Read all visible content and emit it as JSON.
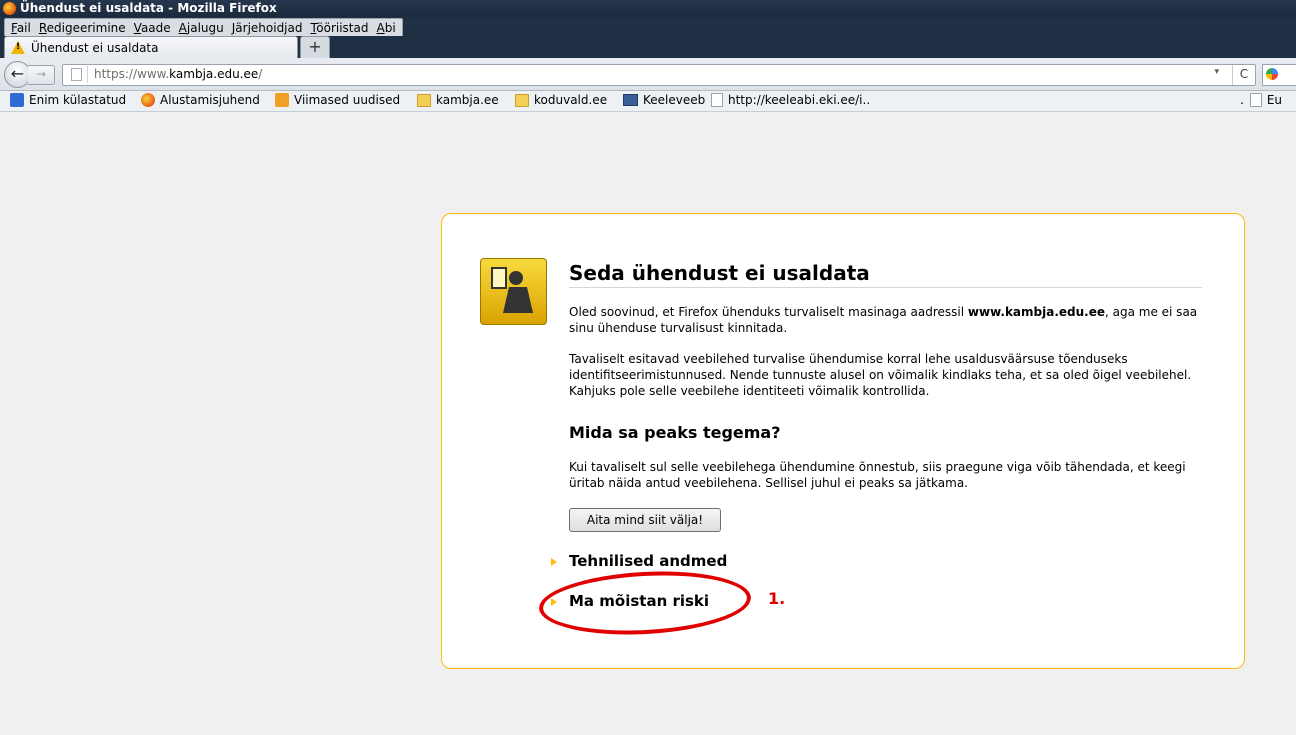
{
  "window": {
    "title": "Ühendust ei usaldata - Mozilla Firefox"
  },
  "menu": [
    "Fail",
    "Redigeerimine",
    "Vaade",
    "Ajalugu",
    "Järjehoidjad",
    "Tööriistad",
    "Abi"
  ],
  "tab": {
    "label": "Ühendust ei usaldata",
    "new_tab": "+"
  },
  "nav": {
    "back": "←",
    "forward": "→",
    "url_prefix": "https://www.",
    "url_domain": "kambja.edu.ee",
    "url_suffix": "/",
    "dropdown": "▾",
    "reload": "C"
  },
  "bookmarks": {
    "items": [
      "Enim külastatud",
      "Alustamisjuhend",
      "Viimased uudised",
      "kambja.ee",
      "koduvald.ee",
      "Keeleveeb",
      "http://keeleabi.eki.ee/i.."
    ],
    "overflow_dot": ".",
    "overflow_label": "Eu"
  },
  "error": {
    "title": "Seda ühendust ei usaldata",
    "p1_before": "Oled soovinud, et Firefox ühenduks turvaliselt masinaga aadressil ",
    "p1_host": "www.kambja.edu.ee",
    "p1_after": ", aga me ei saa sinu ühenduse turvalisust kinnitada.",
    "p2": "Tavaliselt esitavad veebilehed turvalise ühendumise korral lehe usaldusväärsuse tõenduseks identifitseerimistunnused. Nende tunnuste alusel on võimalik kindlaks teha, et sa oled õigel veebilehel. Kahjuks pole selle veebilehe identiteeti võimalik kontrollida.",
    "h2": "Mida sa peaks tegema?",
    "p3": "Kui tavaliselt sul selle veebilehega ühendumine õnnestub, siis praegune viga võib tähendada, et keegi üritab näida antud veebilehena. Sellisel juhul ei peaks sa jätkama.",
    "button": "Aita mind siit välja!",
    "expander1": "Tehnilised andmed",
    "expander2": "Ma mõistan riski"
  },
  "annotation": {
    "number": "1.",
    "color": "#e00000"
  },
  "colors": {
    "box_border": "#ffbd09",
    "titlebar": "#1f2f44"
  }
}
